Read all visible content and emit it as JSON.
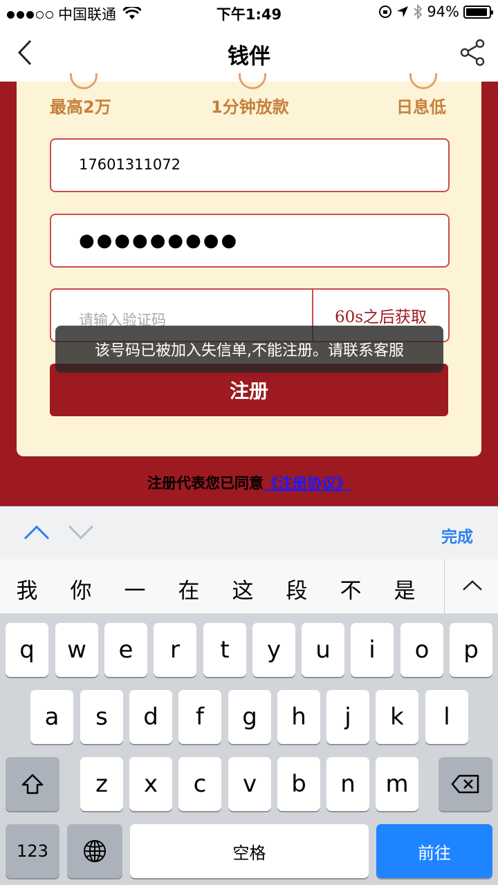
{
  "status_bar": {
    "carrier": "中国联通",
    "time": "下午1:49",
    "battery": "94%",
    "battery_level": 0.94
  },
  "nav": {
    "title": "钱伴"
  },
  "features": [
    "最高2万",
    "1分钟放款",
    "日息低"
  ],
  "form": {
    "phone_value": "17601311072",
    "password_mask": "●●●●●●●●●",
    "code_placeholder": "请输入验证码",
    "code_button": "60s之后获取",
    "register_button": "注册"
  },
  "toast": "该号码已被加入失信单,不能注册。请联系客服",
  "agreement": {
    "prefix": "注册代表您已同意",
    "link": "《注册协议》"
  },
  "accessory": {
    "done": "完成"
  },
  "candidates": [
    "我",
    "你",
    "一",
    "在",
    "这",
    "段",
    "不",
    "是"
  ],
  "keyboard": {
    "row1": [
      "q",
      "w",
      "e",
      "r",
      "t",
      "y",
      "u",
      "i",
      "o",
      "p"
    ],
    "row2": [
      "a",
      "s",
      "d",
      "f",
      "g",
      "h",
      "j",
      "k",
      "l"
    ],
    "row3": [
      "z",
      "x",
      "c",
      "v",
      "b",
      "n",
      "m"
    ],
    "num_key": "123",
    "space_key": "空格",
    "go_key": "前往"
  }
}
